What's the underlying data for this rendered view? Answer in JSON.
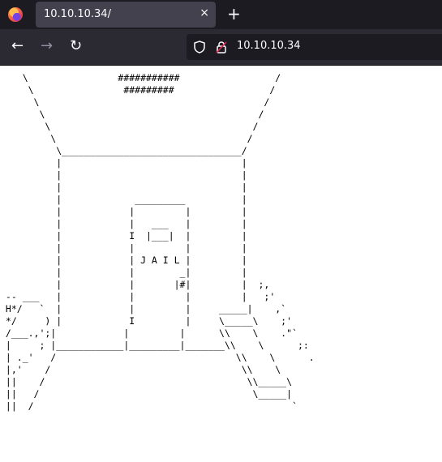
{
  "tab": {
    "title": "10.10.10.34/"
  },
  "toolbar": {
    "new_tab": "+",
    "back": "←",
    "forward": "→",
    "reload": "↻",
    "close": "×"
  },
  "url": {
    "text": "10.10.10.34"
  },
  "page": {
    "ascii_art": "    \\                ###########                 /\n     \\                #########                 /\n      \\                                        /\n       \\                                      /\n        \\                                    /\n         \\                                  /\n          \\________________________________/\n          |                                |\n          |                                |\n          |                                |\n          |             _________          |\n          |            |         |         |\n          |            |   ___   |         |\n          |            I  |___|  |         |\n          |            |         |         |\n          |            | J A I L |         |\n          |            |        _|         |\n          |            |       |#|         |  ;,\n -- ___   |            |         |         |   ;'\n H*/   `  |            |         |     _____|    ,`\n */     ) |            I         |     \\_____\\    ;'\n /___.,';|            |         |      \\\\    \\    .\"`\n |     ; |____________|_________|_______\\\\    \\      ;:\n | ._'   /                                \\\\    \\      .\n |,'    /                                  \\\\    \\\n ||    /                                    \\\\_____\\\n ||   /                                      \\_____|\n ||  /                                              `"
  }
}
